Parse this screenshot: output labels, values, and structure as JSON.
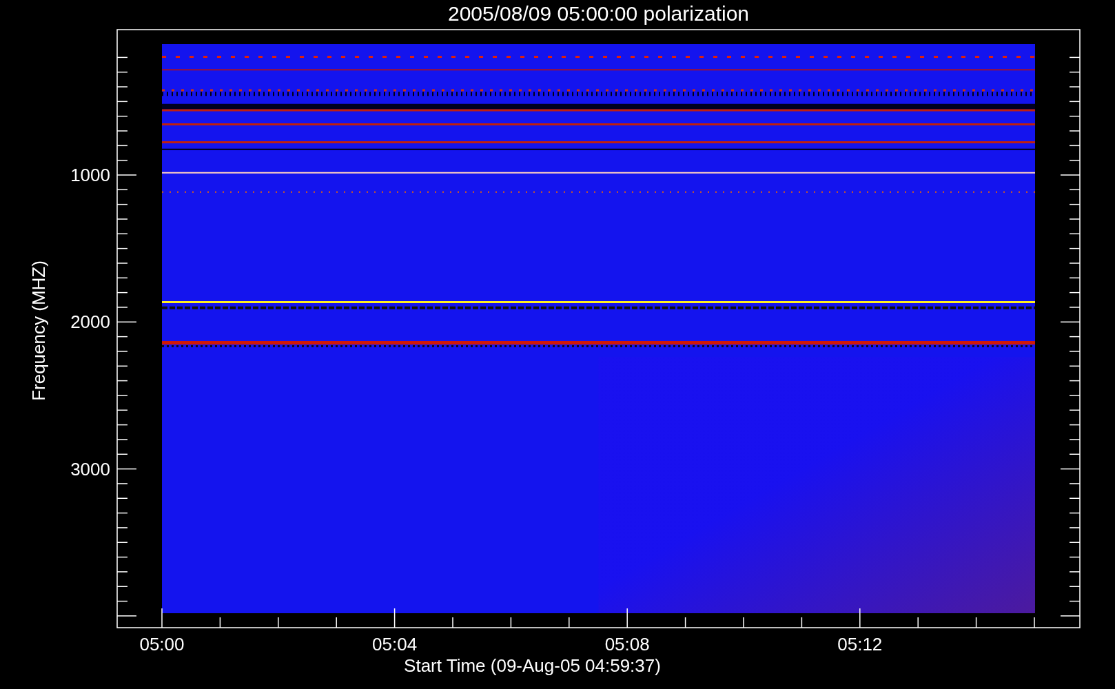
{
  "title": "2005/08/09 05:00:00 polarization",
  "y_axis": {
    "label": "Frequency (MHZ)",
    "ticks": [
      "1000",
      "2000",
      "3000"
    ]
  },
  "x_axis": {
    "label": "Start Time (09-Aug-05 04:59:37)",
    "ticks": [
      "05:00",
      "05:04",
      "05:08",
      "05:12"
    ]
  }
}
